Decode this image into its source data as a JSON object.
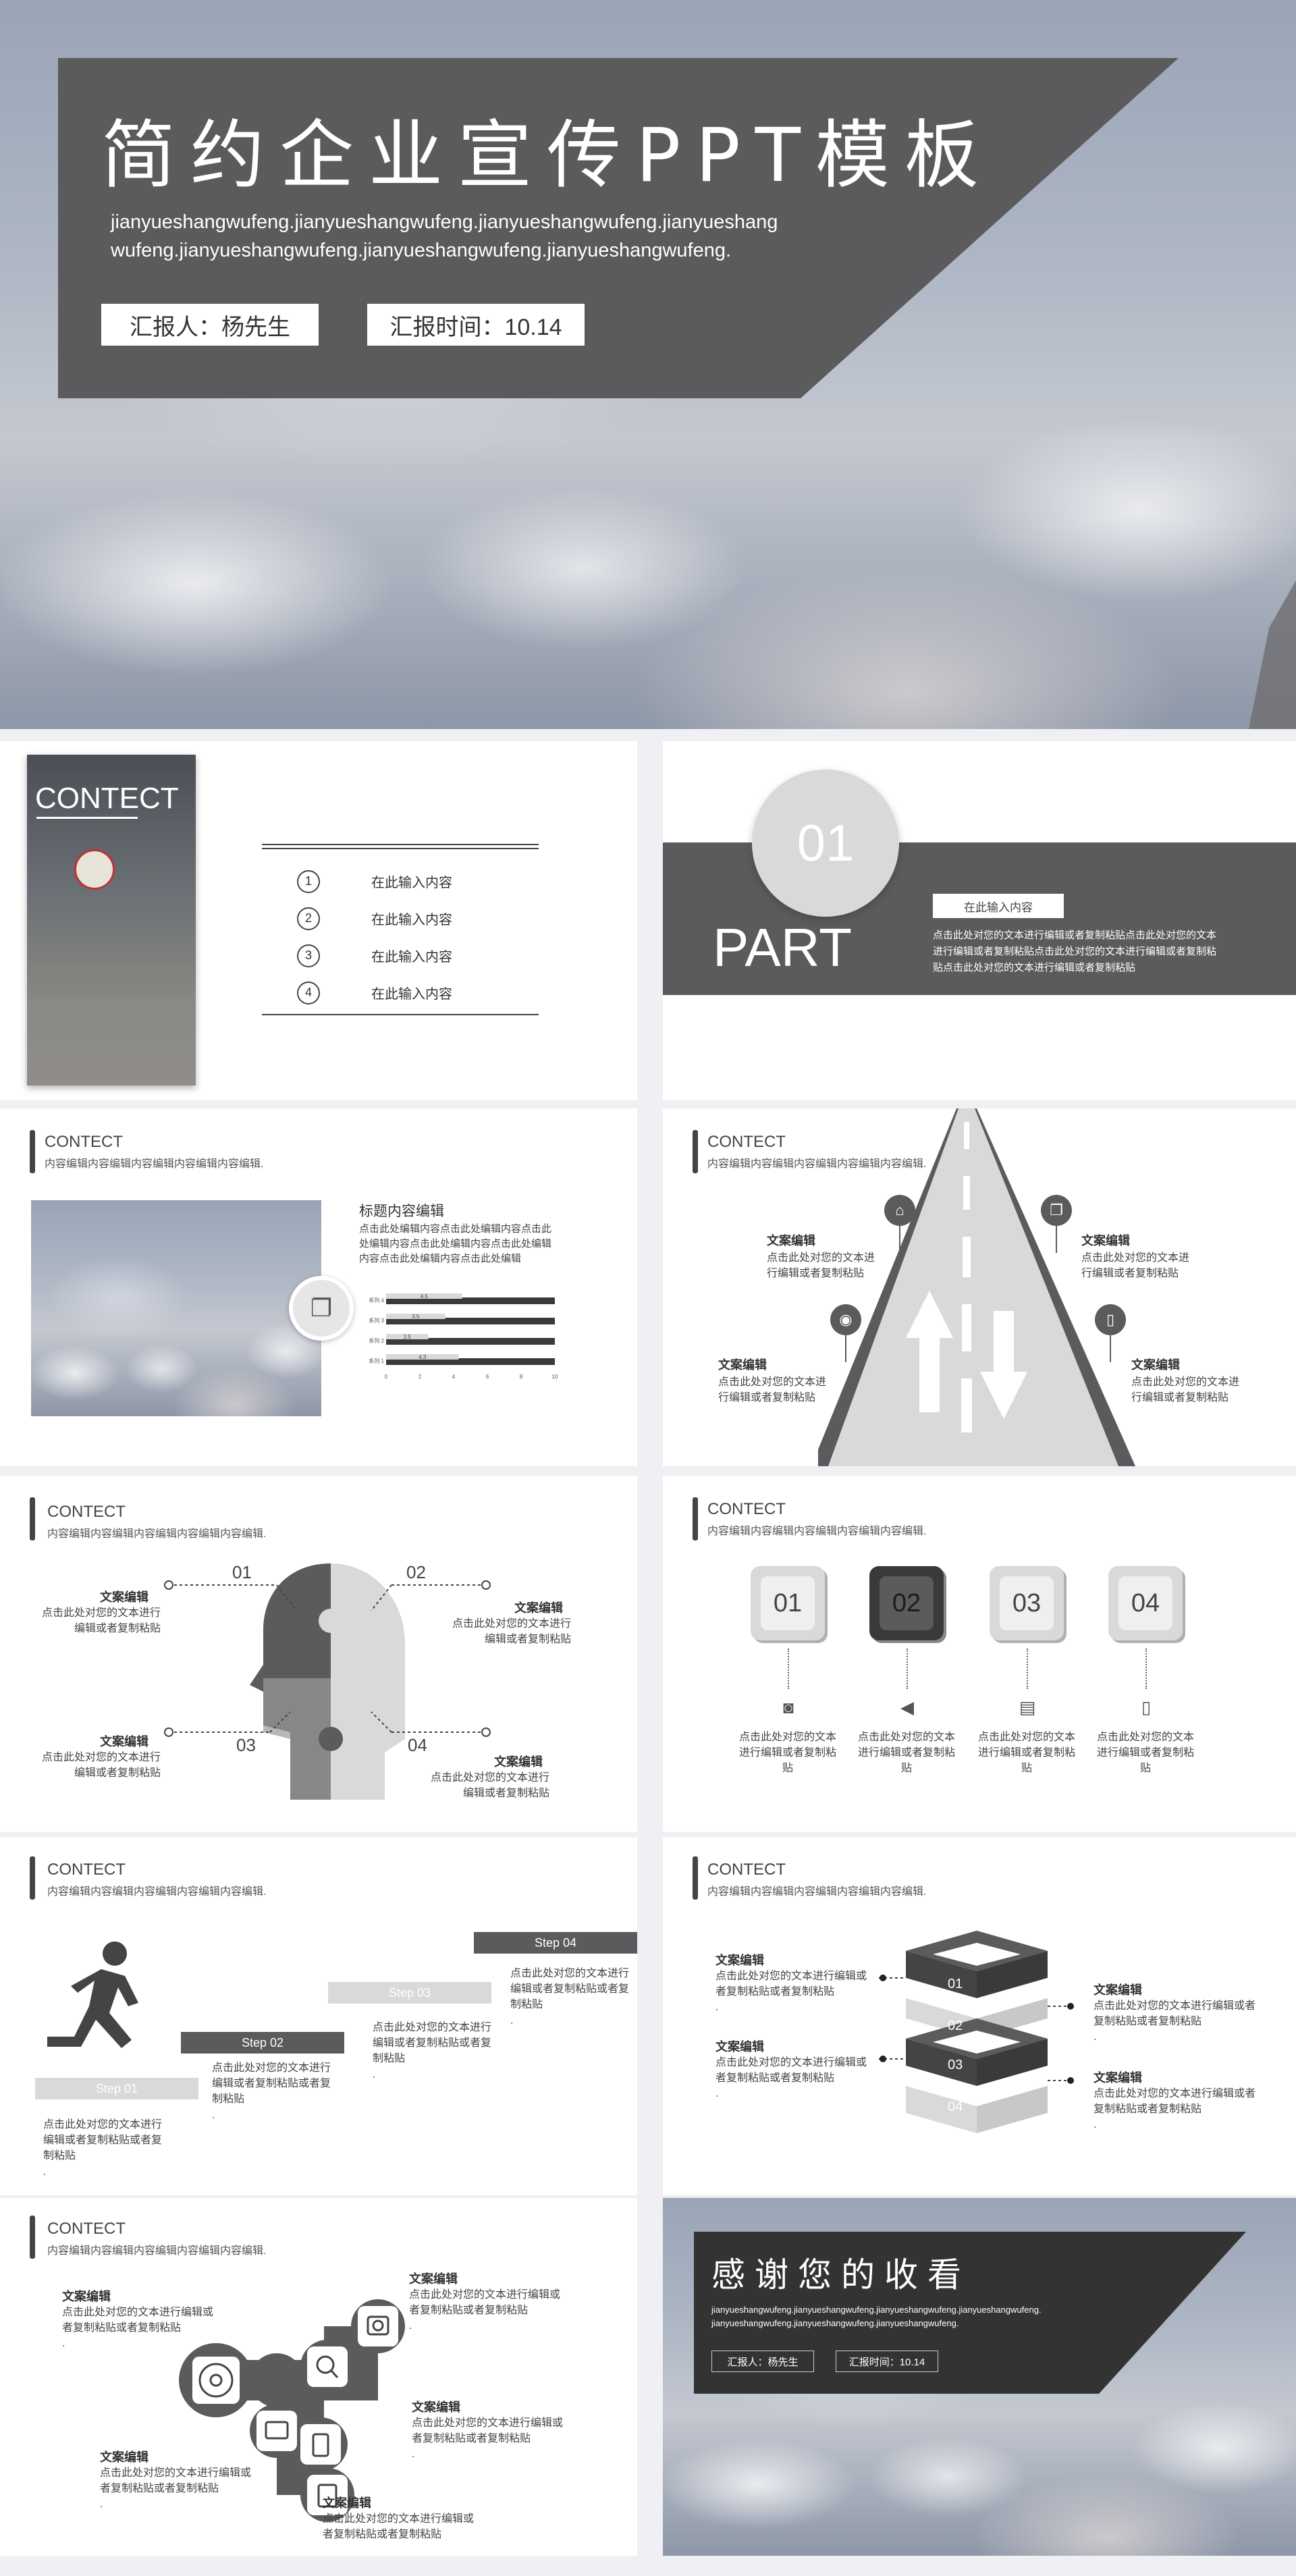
{
  "cover": {
    "title": "简约企业宣传PPT模板",
    "subtitle": "jianyueshangwufeng.jianyueshangwufeng.jianyueshangwufeng.jianyueshangwufeng.jianyueshangwufeng.jianyueshangwufeng.jianyueshangwufeng.",
    "reporter": "汇报人：杨先生",
    "time": "汇报时间：10.14"
  },
  "toc": {
    "heading": "CONTECT",
    "items": [
      {
        "num": "1",
        "label": "在此输入内容"
      },
      {
        "num": "2",
        "label": "在此输入内容"
      },
      {
        "num": "3",
        "label": "在此输入内容"
      },
      {
        "num": "4",
        "label": "在此输入内容"
      }
    ]
  },
  "part": {
    "num": "01",
    "label": "PART",
    "tag": "在此输入内容",
    "text": "点击此处对您的文本进行编辑或者复制粘贴点击此处对您的文本进行编辑或者复制粘贴点击此处对您的文本进行编辑或者复制粘贴点击此处对您的文本进行编辑或者复制粘贴"
  },
  "common": {
    "contect": "CONTECT",
    "contect_sub": "内容编辑内容编辑内容编辑内容编辑内容编辑."
  },
  "slide3": {
    "heading": "标题内容编辑",
    "text": "点击此处编辑内容点击此处编辑内容点击此处编辑内容点击此处编辑内容点击此处编辑内容点击此处编辑内容点击此处编辑",
    "chart_data": {
      "type": "bar",
      "categories": [
        "系列 4",
        "系列 3",
        "系列 2",
        "系列 1"
      ],
      "values": [
        4.5,
        3.5,
        2.5,
        4.3
      ],
      "xlim": [
        0,
        10
      ],
      "xticks": [
        "0",
        "2",
        "4",
        "6",
        "8",
        "10"
      ],
      "orientation": "horizontal"
    }
  },
  "road": {
    "items": [
      {
        "title": "文案编辑",
        "text": "点击此处对您的文本进行编辑或者复制粘贴"
      },
      {
        "title": "文案编辑",
        "text": "点击此处对您的文本进行编辑或者复制粘贴"
      },
      {
        "title": "文案编辑",
        "text": "点击此处对您的文本进行编辑或者复制粘贴"
      },
      {
        "title": "文案编辑",
        "text": "点击此处对您的文本进行编辑或者复制粘贴"
      }
    ]
  },
  "head_slide": {
    "items": [
      {
        "num": "01",
        "title": "文案编辑",
        "text": "点击此处对您的文本进行编辑或者复制粘贴"
      },
      {
        "num": "02",
        "title": "文案编辑",
        "text": "点击此处对您的文本进行编辑或者复制粘贴"
      },
      {
        "num": "03",
        "title": "文案编辑",
        "text": "点击此处对您的文本进行编辑或者复制粘贴"
      },
      {
        "num": "04",
        "title": "文案编辑",
        "text": "点击此处对您的文本进行编辑或者复制粘贴"
      }
    ]
  },
  "keys": {
    "items": [
      {
        "num": "01",
        "text": "点击此处对您的文本进行编辑或者复制粘贴"
      },
      {
        "num": "02",
        "text": "点击此处对您的文本进行编辑或者复制粘贴"
      },
      {
        "num": "03",
        "text": "点击此处对您的文本进行编辑或者复制粘贴"
      },
      {
        "num": "04",
        "text": "点击此处对您的文本进行编辑或者复制粘贴"
      }
    ]
  },
  "steps": {
    "items": [
      {
        "label": "Step 01",
        "text": "点击此处对您的文本进行编辑或者复制粘贴或者复制粘贴"
      },
      {
        "label": "Step 02",
        "text": "点击此处对您的文本进行编辑或者复制粘贴或者复制粘贴"
      },
      {
        "label": "Step 03",
        "text": "点击此处对您的文本进行编辑或者复制粘贴或者复制粘贴"
      },
      {
        "label": "Step 04",
        "text": "点击此处对您的文本进行编辑或者复制粘贴或者复制粘贴"
      }
    ],
    "dot": "."
  },
  "layers": {
    "items": [
      {
        "title": "文案编辑",
        "text": "点击此处对您的文本进行编辑或者复制粘贴或者复制粘贴"
      },
      {
        "title": "文案编辑",
        "text": "点击此处对您的文本进行编辑或者复制粘贴或者复制粘贴"
      },
      {
        "title": "文案编辑",
        "text": "点击此处对您的文本进行编辑或者复制粘贴或者复制粘贴"
      },
      {
        "title": "文案编辑",
        "text": "点击此处对您的文本进行编辑或者复制粘贴或者复制粘贴"
      }
    ],
    "nums": [
      "01",
      "02",
      "03",
      "04"
    ],
    "dot": "."
  },
  "hex": {
    "items": [
      {
        "title": "文案编辑",
        "text": "点击此处对您的文本进行编辑或者复制粘贴或者复制粘贴"
      },
      {
        "title": "文案编辑",
        "text": "点击此处对您的文本进行编辑或者复制粘贴或者复制粘贴"
      },
      {
        "title": "文案编辑",
        "text": "点击此处对您的文本进行编辑或者复制粘贴或者复制粘贴"
      },
      {
        "title": "文案编辑",
        "text": "点击此处对您的文本进行编辑或者复制粘贴或者复制粘贴"
      },
      {
        "title": "文案编辑",
        "text": "点击此处对您的文本进行编辑或者复制粘贴或者复制粘贴"
      }
    ],
    "dot": "."
  },
  "end": {
    "title": "感谢您的收看",
    "subtitle": "jianyueshangwufeng.jianyueshangwufeng.jianyueshangwufeng.jianyueshangwufeng.jianyueshangwufeng.jianyueshangwufeng.jianyueshangwufeng.",
    "reporter": "汇报人：杨先生",
    "time": "汇报时间：10.14"
  },
  "colors": {
    "dark": "#555555",
    "darker": "#3a3a3a",
    "light": "#d9d9d9",
    "bg": "#eef0f3"
  }
}
